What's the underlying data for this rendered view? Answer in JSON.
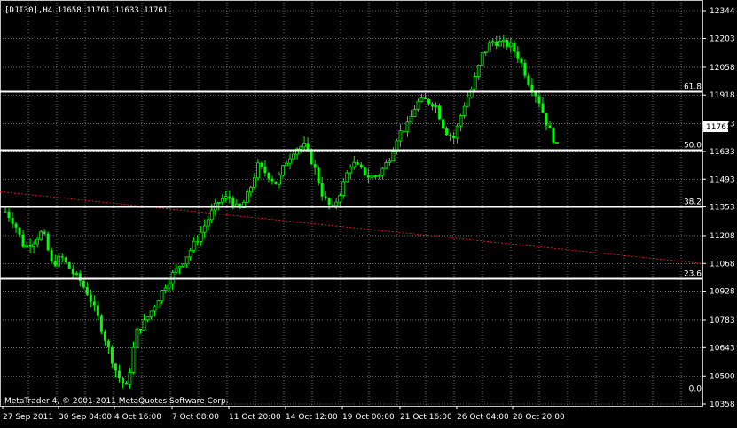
{
  "header": {
    "symbol_info": "[DJI30],H4  11658 11761 11633 11761"
  },
  "copyright": "MetaTrader 4, © 2001-2011 MetaQuotes Software Corp.",
  "current_price_label": "11761",
  "colors": {
    "background": "#000000",
    "candle_bull": "#00ff00",
    "candle_bear": "#00ff00",
    "grid": "#c0c0c0",
    "fib_lines": "#ffffff",
    "trendline": "#ff2020",
    "axis_text": "#ffffff"
  },
  "chart_data": {
    "type": "candlestick",
    "symbol": "DJI30",
    "timeframe": "H4",
    "ylim": [
      10358,
      12344
    ],
    "y_ticks": [
      "12344",
      "12203",
      "12058",
      "11918",
      "11773",
      "11633",
      "11493",
      "11353",
      "11208",
      "11068",
      "10928",
      "10783",
      "10643",
      "10500",
      "10358"
    ],
    "x_ticks": [
      "27 Sep 2011",
      "30 Sep 04:00",
      "4 Oct 16:00",
      "7 Oct 08:00",
      "11 Oct 20:00",
      "14 Oct 12:00",
      "19 Oct 00:00",
      "21 Oct 16:00",
      "26 Oct 04:00",
      "28 Oct 20:00"
    ],
    "fib_levels": [
      {
        "label": "61.8",
        "price": 11935
      },
      {
        "label": "50.0",
        "price": 11640
      },
      {
        "label": "38.2",
        "price": 11355
      },
      {
        "label": "23.6",
        "price": 10995
      },
      {
        "label": "0.0",
        "price": 10410
      }
    ],
    "trendline": {
      "start_price": 11430,
      "end_price": 11068
    },
    "price_path": [
      11330,
      11270,
      11150,
      11180,
      11230,
      11060,
      11100,
      11030,
      10980,
      10900,
      10780,
      10640,
      10500,
      10440,
      10720,
      10780,
      10860,
      10950,
      11020,
      11080,
      11150,
      11230,
      11320,
      11390,
      11400,
      11330,
      11420,
      11560,
      11520,
      11470,
      11580,
      11650,
      11660,
      11560,
      11400,
      11340,
      11450,
      11580,
      11540,
      11500,
      11520,
      11590,
      11720,
      11760,
      11880,
      11890,
      11870,
      11740,
      11700,
      11860,
      11960,
      12120,
      12190,
      12180,
      12170,
      12100,
      11980,
      11900,
      11760,
      11660
    ]
  }
}
